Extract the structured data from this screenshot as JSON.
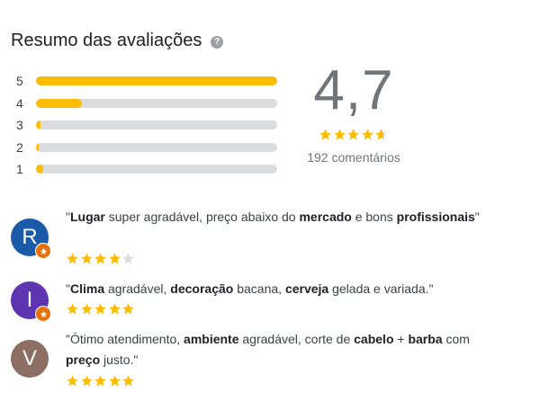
{
  "header": {
    "title": "Resumo das avaliações",
    "help_icon": "?"
  },
  "rating_bars": [
    {
      "label": "5",
      "fraction": 1.0
    },
    {
      "label": "4",
      "fraction": 0.19
    },
    {
      "label": "3",
      "fraction": 0.02
    },
    {
      "label": "2",
      "fraction": 0.005
    },
    {
      "label": "1",
      "fraction": 0.03
    }
  ],
  "summary": {
    "score": "4,7",
    "stars": 4.7,
    "count": "192 comentários"
  },
  "colors": {
    "star": "#fbbc04",
    "star_empty": "#dadce0",
    "badge": "#e8710a"
  },
  "reviews": [
    {
      "initial": "R",
      "avatar_color": "#1a5aa8",
      "badge": true,
      "stars": 4,
      "segments": [
        {
          "t": "\"",
          "b": false
        },
        {
          "t": "Lugar",
          "b": true
        },
        {
          "t": " super agradável, preço abaixo do ",
          "b": false
        },
        {
          "t": "mercado",
          "b": true
        },
        {
          "t": " e bons ",
          "b": false
        },
        {
          "t": "profissionais",
          "b": true
        },
        {
          "t": "\"",
          "b": false
        }
      ]
    },
    {
      "initial": "I",
      "avatar_color": "#5e35b1",
      "badge": true,
      "stars": 5,
      "segments": [
        {
          "t": "\"",
          "b": false
        },
        {
          "t": "Clima",
          "b": true
        },
        {
          "t": " agradável, ",
          "b": false
        },
        {
          "t": "decoração",
          "b": true
        },
        {
          "t": " bacana, ",
          "b": false
        },
        {
          "t": "cerveja",
          "b": true
        },
        {
          "t": " gelada e variada.\"",
          "b": false
        }
      ]
    },
    {
      "initial": "V",
      "avatar_color": "#8d6e63",
      "badge": false,
      "stars": 5,
      "segments": [
        {
          "t": "\"Ótimo atendimento, ",
          "b": false
        },
        {
          "t": "ambiente",
          "b": true
        },
        {
          "t": " agradável, corte de ",
          "b": false
        },
        {
          "t": "cabelo",
          "b": true
        },
        {
          "t": " + ",
          "b": false
        },
        {
          "t": "barba",
          "b": true
        },
        {
          "t": " com ",
          "b": false
        },
        {
          "t": "preço",
          "b": true
        },
        {
          "t": " justo.\"",
          "b": false
        }
      ]
    }
  ]
}
